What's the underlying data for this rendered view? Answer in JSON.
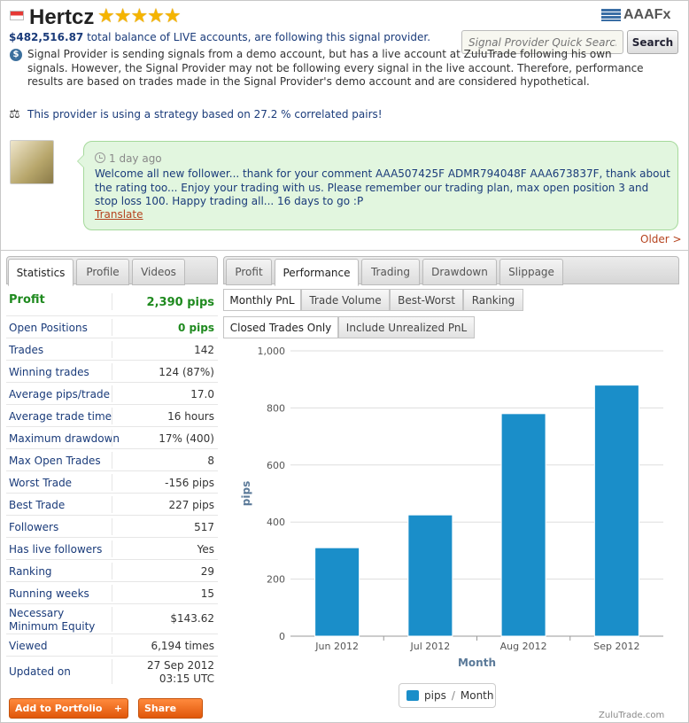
{
  "header": {
    "title": "Hertcz",
    "stars": "★★★★★",
    "brand": "AAAFx",
    "balance_amount": "$482,516.87",
    "balance_text": " total balance of LIVE accounts, are following this signal provider.",
    "notice": "Signal Provider is sending signals from a demo account, but has a live account at ZuluTrade following his own signals. However, the Signal Provider may not be following every signal in the live account. Therefore, performance results are based on trades made in the Signal Provider's demo account and are considered hypothetical.",
    "correlation": "This provider is using a strategy based on 27.2 % correlated pairs!"
  },
  "search": {
    "placeholder": "Signal Provider Quick Search",
    "button": "Search"
  },
  "comment": {
    "time": "1 day ago",
    "text": "Welcome all new follower... thank for your comment AAA507425F ADMR794048F AAA673837F, thank about the rating too... Enjoy your trading with us. Please remember our trading plan, max open position 3 and stop loss 100. Happy trading all... 16 days to go :P",
    "translate": "Translate",
    "older": "Older >"
  },
  "left_tabs": [
    "Statistics",
    "Profile",
    "Videos"
  ],
  "right_tabs": [
    "Profit",
    "Performance",
    "Trading",
    "Drawdown",
    "Slippage"
  ],
  "sub_tabs": [
    "Monthly PnL",
    "Trade Volume",
    "Best-Worst",
    "Ranking"
  ],
  "filter_tabs": [
    "Closed Trades Only",
    "Include Unrealized PnL"
  ],
  "stats": [
    {
      "label": "Profit",
      "value": "2,390 pips"
    },
    {
      "label": "Open Positions",
      "value": "0 pips"
    },
    {
      "label": "Trades",
      "value": "142"
    },
    {
      "label": "Winning trades",
      "value": "124 (87%)"
    },
    {
      "label": "Average pips/trade",
      "value": "17.0"
    },
    {
      "label": "Average trade time",
      "value": "16 hours"
    },
    {
      "label": "Maximum drawdown",
      "value": "17% (400)"
    },
    {
      "label": "Max Open Trades",
      "value": "8"
    },
    {
      "label": "Worst Trade",
      "value": "-156 pips"
    },
    {
      "label": "Best Trade",
      "value": "227 pips"
    },
    {
      "label": "Followers",
      "value": "517"
    },
    {
      "label": "Has live followers",
      "value": "Yes"
    },
    {
      "label": "Ranking",
      "value": "29"
    },
    {
      "label": "Running weeks",
      "value": "15"
    },
    {
      "label": "Necessary Minimum Equity",
      "value": "$143.62"
    },
    {
      "label": "Viewed",
      "value": "6,194 times"
    },
    {
      "label": "Updated on",
      "value": "27 Sep 2012 03:15 UTC"
    }
  ],
  "buttons": {
    "add": "Add to Portfolio",
    "add_plus": "+",
    "share": "Share"
  },
  "footer": "ZuluTrade.com",
  "colors": {
    "bar": "#1a8ec9",
    "accent": "#e0560a",
    "bubble": "#e2f6df"
  },
  "chart_data": {
    "type": "bar",
    "categories": [
      "Jun 2012",
      "Jul 2012",
      "Aug 2012",
      "Sep 2012"
    ],
    "values": [
      310,
      425,
      780,
      880
    ],
    "xlabel": "Month",
    "ylabel": "pips",
    "ylim": [
      0,
      1000
    ],
    "yticks": [
      0,
      200,
      400,
      600,
      800,
      1000
    ],
    "ytick_labels": [
      "0",
      "200",
      "400",
      "600",
      "800",
      "1,000"
    ],
    "legend": {
      "series": "pips",
      "sep": "/",
      "x": "Month"
    },
    "grid": true
  }
}
